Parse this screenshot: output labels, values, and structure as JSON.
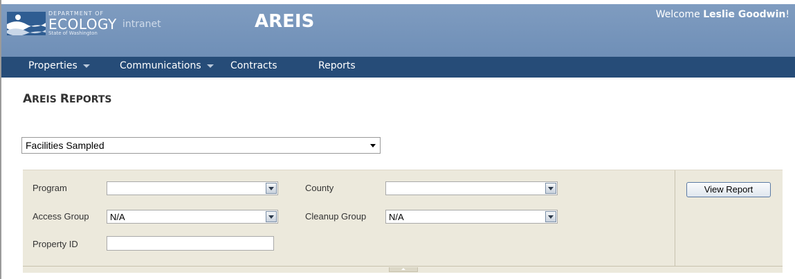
{
  "header": {
    "logo": {
      "dept_text": "DEPARTMENT OF",
      "ecology_text": "ECOLOGY",
      "intranet_text": "intranet",
      "state_text": "State of Washington"
    },
    "app_title": "AREIS",
    "welcome_prefix": "Welcome ",
    "user_name": "Leslie Goodwin",
    "welcome_suffix": "!"
  },
  "nav": {
    "items": [
      {
        "label": "Properties",
        "has_menu": true
      },
      {
        "label": "Communications",
        "has_menu": true
      },
      {
        "label": "Contracts",
        "has_menu": false
      },
      {
        "label": "Reports",
        "has_menu": false
      }
    ]
  },
  "page": {
    "title_first_letter": "A",
    "title_first_rest": "REIS",
    "title_second_letter": "R",
    "title_second_rest": "EPORTS"
  },
  "report_selector": {
    "selected": "Facilities Sampled"
  },
  "filters": {
    "program_label": "Program",
    "program_value": "",
    "county_label": "County",
    "county_value": "",
    "access_group_label": "Access Group",
    "access_group_value": "N/A",
    "cleanup_group_label": "Cleanup Group",
    "cleanup_group_value": "N/A",
    "property_id_label": "Property ID",
    "property_id_value": ""
  },
  "actions": {
    "view_report_label": "View Report"
  },
  "colors": {
    "header_bg": "#7a98bd",
    "nav_bg": "#264c78",
    "panel_bg": "#ece9dc"
  }
}
